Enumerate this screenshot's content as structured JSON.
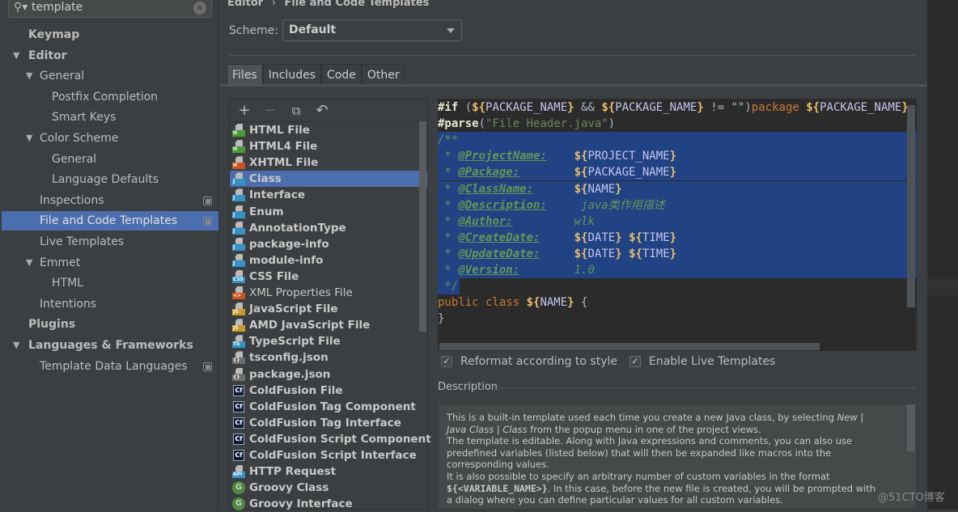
{
  "search": {
    "value": "template",
    "icon": "search-icon",
    "clear_icon": "clear-icon"
  },
  "sidebar": {
    "items": [
      {
        "label": "Keymap",
        "level": 0,
        "bold": true
      },
      {
        "label": "Editor",
        "level": 0,
        "bold": true,
        "expanded": true
      },
      {
        "label": "General",
        "level": 1,
        "expanded": true
      },
      {
        "label": "Postfix Completion",
        "level": 2
      },
      {
        "label": "Smart Keys",
        "level": 2
      },
      {
        "label": "Color Scheme",
        "level": 1,
        "expanded": true
      },
      {
        "label": "General",
        "level": 2
      },
      {
        "label": "Language Defaults",
        "level": 2
      },
      {
        "label": "Inspections",
        "level": 1,
        "copy": true
      },
      {
        "label": "File and Code Templates",
        "level": 1,
        "copy": true,
        "selected": true
      },
      {
        "label": "Live Templates",
        "level": 1
      },
      {
        "label": "Emmet",
        "level": 1,
        "expanded": true
      },
      {
        "label": "HTML",
        "level": 2
      },
      {
        "label": "Intentions",
        "level": 1
      },
      {
        "label": "Plugins",
        "level": 0,
        "bold": true
      },
      {
        "label": "Languages & Frameworks",
        "level": 0,
        "bold": true,
        "expanded": true
      },
      {
        "label": "Template Data Languages",
        "level": 1,
        "copy": true
      }
    ]
  },
  "breadcrumb": {
    "parent": "Editor",
    "separator": "›",
    "current": "File and Code Templates"
  },
  "scheme": {
    "label": "Scheme:",
    "value": "Default"
  },
  "tabs": [
    "Files",
    "Includes",
    "Code",
    "Other"
  ],
  "active_tab": "Files",
  "toolbar": {
    "add": "+",
    "remove": "−",
    "copy": "⧉",
    "reset": "↶"
  },
  "files": [
    {
      "name": "HTML File",
      "badge": "H",
      "color": "#4e9a3a"
    },
    {
      "name": "HTML4 File",
      "badge": "H",
      "color": "#4e9a3a"
    },
    {
      "name": "XHTML File",
      "badge": "H",
      "color": "#c9541f"
    },
    {
      "name": "Class",
      "badge": "J",
      "color": "#3592c4",
      "selected": true
    },
    {
      "name": "Interface",
      "badge": "J",
      "color": "#3592c4"
    },
    {
      "name": "Enum",
      "badge": "J",
      "color": "#3592c4"
    },
    {
      "name": "AnnotationType",
      "badge": "J",
      "color": "#3592c4"
    },
    {
      "name": "package-info",
      "badge": "J",
      "color": "#3592c4"
    },
    {
      "name": "module-info",
      "badge": "J",
      "color": "#3592c4"
    },
    {
      "name": "CSS File",
      "badge": "CSS",
      "color": "#3592c4"
    },
    {
      "name": "XML Properties File",
      "badge": "<>",
      "color": "#c9541f",
      "plain": true
    },
    {
      "name": "JavaScript File",
      "badge": "JS",
      "color": "#c99a2e"
    },
    {
      "name": "AMD JavaScript File",
      "badge": "JS",
      "color": "#c99a2e"
    },
    {
      "name": "TypeScript File",
      "badge": "TS",
      "color": "#3592c4"
    },
    {
      "name": "tsconfig.json",
      "badge": "{}",
      "color": "#6e6e6e"
    },
    {
      "name": "package.json",
      "badge": "{}",
      "color": "#6e6e6e"
    },
    {
      "name": "ColdFusion File",
      "badge": "Cf",
      "kind": "cf"
    },
    {
      "name": "ColdFusion Tag Component",
      "badge": "Cf",
      "kind": "cf"
    },
    {
      "name": "ColdFusion Tag Interface",
      "badge": "Cf",
      "kind": "cf"
    },
    {
      "name": "ColdFusion Script Component",
      "badge": "Cf",
      "kind": "cf"
    },
    {
      "name": "ColdFusion Script Interface",
      "badge": "Cf",
      "kind": "cf"
    },
    {
      "name": "HTTP Request",
      "badge": "API",
      "color": "#3592c4"
    },
    {
      "name": "Groovy Class",
      "badge": "G",
      "kind": "groovy"
    },
    {
      "name": "Groovy Interface",
      "badge": "G",
      "kind": "groovy"
    }
  ],
  "code": [
    {
      "seg": [
        [
          "#if",
          "kw"
        ],
        [
          " (",
          "op"
        ],
        [
          "${",
          "br"
        ],
        [
          "PACKAGE_NAME",
          "vn"
        ],
        [
          "}",
          "br"
        ],
        [
          " && ",
          "op"
        ],
        [
          "${",
          "br"
        ],
        [
          "PACKAGE_NAME",
          "vn"
        ],
        [
          "}",
          "br"
        ],
        [
          " != \"\")",
          "op"
        ],
        [
          "package ",
          "or"
        ],
        [
          "${",
          "br"
        ],
        [
          "PACKAGE_NAME",
          "vn"
        ],
        [
          "}",
          "br"
        ]
      ]
    },
    {
      "seg": [
        [
          "#parse",
          "kw"
        ],
        [
          "(",
          "op"
        ],
        [
          "\"File Header.java\"",
          "st"
        ],
        [
          ")",
          "op"
        ]
      ]
    },
    {
      "hl": true,
      "seg": [
        [
          "/**",
          "cm"
        ]
      ]
    },
    {
      "hl": true,
      "seg": [
        [
          " * ",
          "cm"
        ],
        [
          "@ProjectName:",
          "tg"
        ],
        [
          "    ",
          "cm"
        ],
        [
          "${",
          "br"
        ],
        [
          "PROJECT_NAME",
          "vn"
        ],
        [
          "}",
          "br"
        ]
      ]
    },
    {
      "hl": true,
      "seg": [
        [
          " * ",
          "cm"
        ],
        [
          "@Package:",
          "tg"
        ],
        [
          "        ",
          "cm"
        ],
        [
          "${",
          "br"
        ],
        [
          "PACKAGE_NAME",
          "vn"
        ],
        [
          "}",
          "br"
        ]
      ]
    },
    {
      "hl": true,
      "seg": [
        [
          " * ",
          "cm"
        ],
        [
          "@ClassName:",
          "tg"
        ],
        [
          "      ",
          "cm"
        ],
        [
          "${",
          "br"
        ],
        [
          "NAME",
          "vn"
        ],
        [
          "}",
          "br"
        ]
      ]
    },
    {
      "hl": true,
      "seg": [
        [
          " * ",
          "cm"
        ],
        [
          "@Description:",
          "tg"
        ],
        [
          "     java类作用描述",
          "cm"
        ]
      ]
    },
    {
      "hl": true,
      "seg": [
        [
          " * ",
          "cm"
        ],
        [
          "@Author:",
          "tg"
        ],
        [
          "         wlk",
          "cm"
        ]
      ]
    },
    {
      "hl": true,
      "seg": [
        [
          " * ",
          "cm"
        ],
        [
          "@CreateDate:",
          "tg"
        ],
        [
          "     ",
          "cm"
        ],
        [
          "${",
          "br"
        ],
        [
          "DATE",
          "vn"
        ],
        [
          "}",
          "br"
        ],
        [
          " ",
          "cm"
        ],
        [
          "${",
          "br"
        ],
        [
          "TIME",
          "vn"
        ],
        [
          "}",
          "br"
        ]
      ]
    },
    {
      "hl": true,
      "seg": [
        [
          " * ",
          "cm"
        ],
        [
          "@UpdateDate:",
          "tg"
        ],
        [
          "     ",
          "cm"
        ],
        [
          "${",
          "br"
        ],
        [
          "DATE",
          "vn"
        ],
        [
          "}",
          "br"
        ],
        [
          " ",
          "cm"
        ],
        [
          "${",
          "br"
        ],
        [
          "TIME",
          "vn"
        ],
        [
          "}",
          "br"
        ]
      ]
    },
    {
      "hl": true,
      "seg": [
        [
          " * ",
          "cm"
        ],
        [
          "@Version:",
          "tg"
        ],
        [
          "        1.0",
          "cm"
        ]
      ]
    },
    {
      "hlpart": true,
      "seg": [
        [
          " */",
          "cm"
        ]
      ]
    },
    {
      "seg": [
        [
          "public class ",
          "or"
        ],
        [
          "${",
          "br"
        ],
        [
          "NAME",
          "vn"
        ],
        [
          "}",
          "br"
        ],
        [
          " {",
          "op"
        ]
      ]
    },
    {
      "seg": [
        [
          "}",
          "op"
        ]
      ]
    }
  ],
  "options": {
    "reformat": {
      "label": "Reformat according to style",
      "checked": true
    },
    "live_templates": {
      "label": "Enable Live Templates",
      "checked": true
    }
  },
  "description": {
    "label": "Description",
    "paragraphs": [
      [
        [
          "This is a built-in template used each time you create a new Java class, by selecting ",
          ""
        ],
        [
          "New | Java Class | Class",
          "i"
        ],
        [
          " from the popup menu in one of the project views.",
          ""
        ]
      ],
      [
        [
          "The template is editable. Along with Java expressions and comments, you can also use predefined variables (listed below) that will then be expanded like macros into the corresponding values.",
          ""
        ]
      ],
      [
        [
          "It is also possible to specify an arbitrary number of custom variables in the format ",
          ""
        ],
        [
          "${<VARIABLE_NAME>}",
          "b"
        ],
        [
          ". In this case, before the new file is created, you will be prompted with a dialog where you can define particular values for all custom variables.",
          ""
        ]
      ]
    ]
  },
  "watermark": "@51CTO博客",
  "colors": {
    "selection": "#4b6eaf",
    "editor_bg": "#2b2b2b",
    "panel_bg": "#3c3f41",
    "code_selection": "#214283"
  }
}
